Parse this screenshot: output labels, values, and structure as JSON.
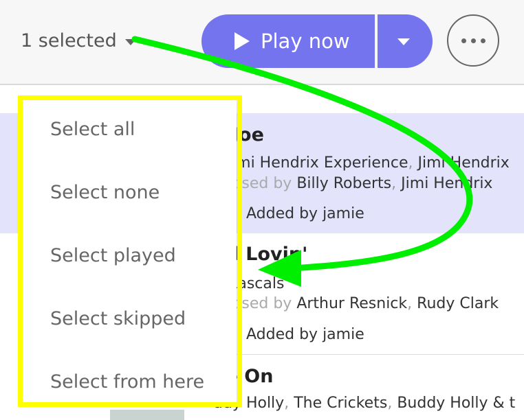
{
  "toolbar": {
    "selected_label": "1 selected",
    "play_label": "Play now"
  },
  "tracks": [
    {
      "title": "Hey Joe",
      "title_visible": "y Joe",
      "artist_prefix": "e ",
      "artists": [
        "Jimi Hendrix Experience",
        "Jimi Hendrix"
      ],
      "composed_prefix": "nposed by",
      "composers": [
        "Billy Roberts",
        "Jimi Hendrix"
      ],
      "added": "Added by jamie",
      "selected": true
    },
    {
      "title_visible": "od Lovin'",
      "artist_prefix": "e ",
      "artists": [
        "Rascals"
      ],
      "composed_prefix": "nposed by",
      "composers": [
        "Arthur Resnick",
        "Rudy Clark"
      ],
      "added": "Added by jamie",
      "selected": false
    },
    {
      "title_visible": "ve On",
      "artist_prefix": "",
      "artists": [
        "ddy Holly",
        "The Crickets",
        "Buddy Holly & t"
      ],
      "selected": false
    }
  ],
  "menu": {
    "items": [
      "Select all",
      "Select none",
      "Select played",
      "Select skipped",
      "Select from here"
    ]
  },
  "colors": {
    "accent": "#7474ee",
    "selected_row": "#e3e3fb",
    "highlight": "#ffff00",
    "arrow": "#00ee00"
  }
}
